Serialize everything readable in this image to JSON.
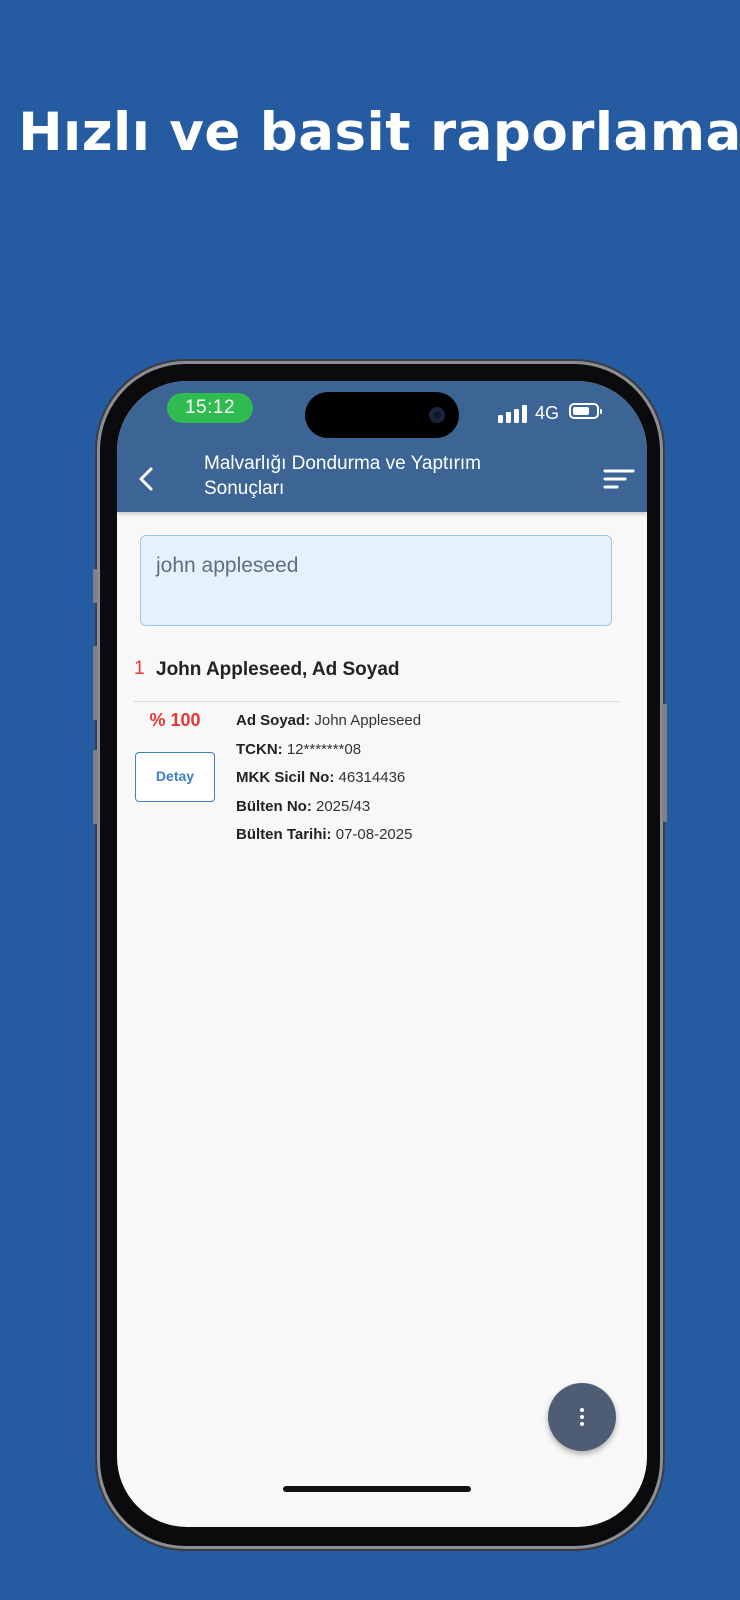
{
  "promo": {
    "headline": "Hızlı ve basit raporlama"
  },
  "status_bar": {
    "time": "15:12",
    "network": "4G",
    "icons": [
      "signal-icon",
      "battery-icon"
    ]
  },
  "app_bar": {
    "title": "Malvarlığı Dondurma ve Yaptırım Sonuçları",
    "back_icon": "chevron-left-icon",
    "sort_icon": "sort-icon"
  },
  "search": {
    "value": "john appleseed"
  },
  "results": [
    {
      "index": "1",
      "name": "John Appleseed, Ad Soyad",
      "match": "% 100",
      "detail_button": "Detay",
      "fields": [
        {
          "label": "Ad Soyad:",
          "value": "John Appleseed"
        },
        {
          "label": "TCKN:",
          "value": "12*******08"
        },
        {
          "label": "MKK Sicil No:",
          "value": "46314436"
        },
        {
          "label": "Bülten No:",
          "value": "2025/43"
        },
        {
          "label": "Bülten Tarihi:",
          "value": "07-08-2025"
        }
      ]
    }
  ],
  "fab": {
    "icon": "more-vertical-icon"
  },
  "colors": {
    "background": "#245ba1",
    "app_bar": "#3c6596",
    "accent_red": "#e53935",
    "button_blue": "#3e7ec4",
    "time_pill": "#2fbb4f",
    "fab": "#4f5d74"
  }
}
